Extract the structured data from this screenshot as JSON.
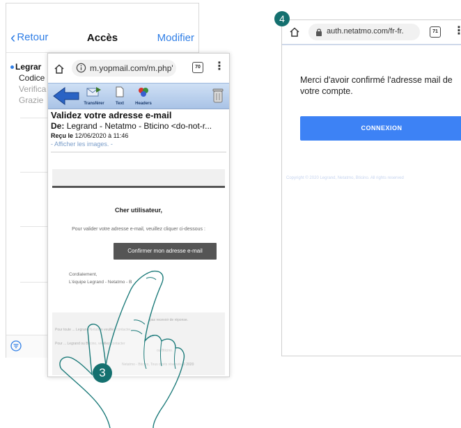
{
  "left_phone": {
    "nav": {
      "back_label": "Retour",
      "title": "Accès",
      "edit_label": "Modifier"
    },
    "mail_item": {
      "sender": "Legrar",
      "line1": "Codice",
      "line2": "Verifica",
      "line3": "Grazie"
    },
    "toolbar": {
      "filter_icon": "filter-icon"
    }
  },
  "front_phone": {
    "browser": {
      "url": "m.yopmail.com/m.php'",
      "tabs_count": "70"
    },
    "yopmail_toolbar": {
      "forward_label": "Transférer",
      "text_label": "Text",
      "headers_label": "Headers"
    },
    "email": {
      "subject": "Validez votre adresse e-mail",
      "from_prefix": "De:",
      "from": "Legrand - Netatmo - Bticino <do-not-r...",
      "date_prefix": "Reçu le",
      "date": "12/06/2020 à 11:46",
      "show_images": "- Afficher les images. -",
      "greeting": "Cher utilisateur,",
      "instruction": "Pour valider votre adresse e-mail, veuillez cliquer ci-dessous :",
      "confirm_button": "Confirmer mon adresse e-mail",
      "regards": "Cordialement,",
      "team": "L'équipe Legrand - Netatmo - B",
      "footer": {
        "line1": "pas recevoir de réponse.",
        "line2": "Pour toute ... Legrand/Netatmo veuillez contacter",
        "line3": "ici",
        "line4": "Pour ... Legrand ou Bticino, veuillez contacter",
        "line5": "ou Bticino.",
        "copyright": "Netatmo - Bticino, Tous droits réservés © 2020"
      }
    }
  },
  "right_phone": {
    "browser": {
      "url": "auth.netatmo.com/fr-fr.",
      "tabs_count": "71"
    },
    "message": "Merci d'avoir confirmé l'adresse mail de votre compte.",
    "connexion_button": "CONNEXION",
    "copyright": "Copyright © 2020 Legrand, Netatmo, Bticino. All rights reserved"
  },
  "steps": {
    "step3": "3",
    "step4": "4"
  },
  "colors": {
    "ios_blue": "#2f7ee6",
    "step_teal": "#14706f",
    "connexion_blue": "#3d82f5",
    "yopmail_toolbar": "#a9c3e6"
  }
}
